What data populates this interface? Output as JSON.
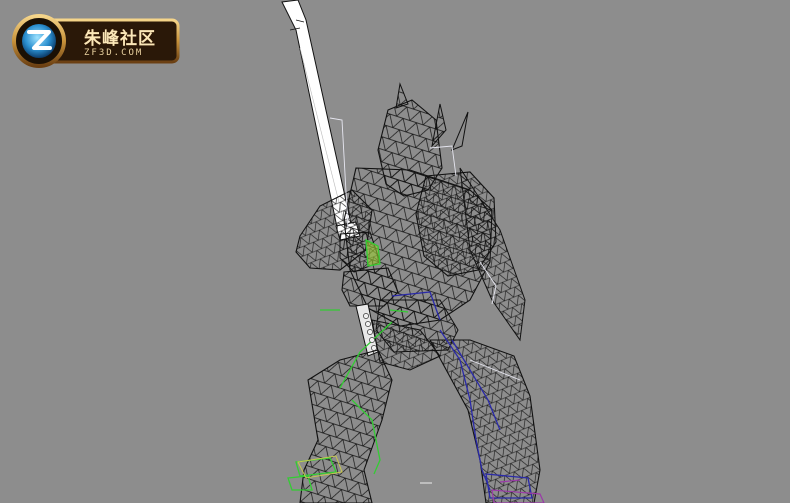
{
  "logo": {
    "title": "朱峰社区",
    "url": "ZF3D.COM",
    "icon": "z-letter-icon",
    "gold": "#c8923a",
    "dark": "#2a1808"
  },
  "viewport": {
    "background": "#8d8d8d",
    "wire_color": "#000000",
    "sword_color": "#ffffff",
    "bone_green": "#33cc33",
    "bone_blue": "#2a2aa8",
    "bone_purple": "#9a3aa8",
    "helper_white": "#e6e6f0"
  }
}
